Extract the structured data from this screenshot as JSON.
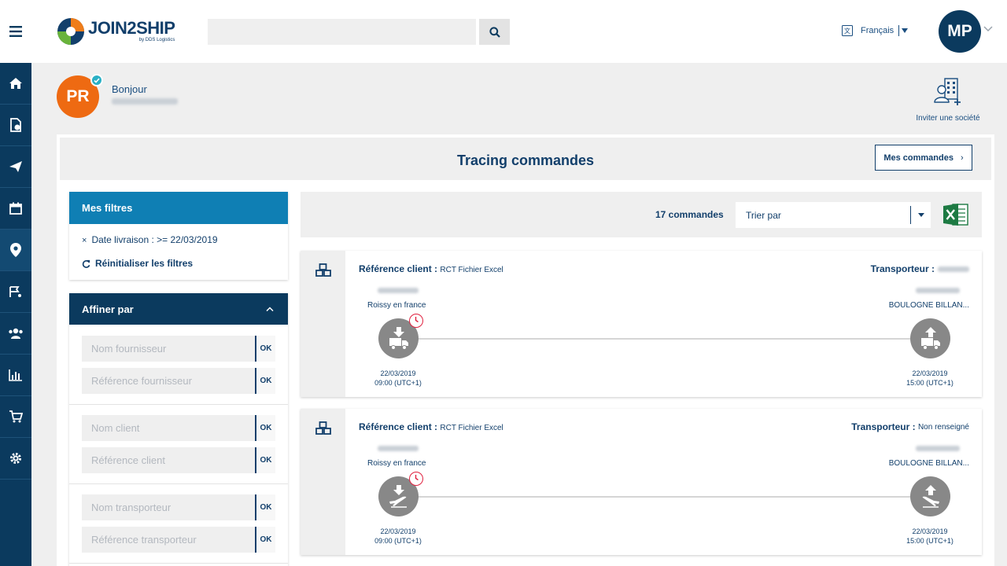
{
  "app": {
    "logo_main": "JOIN2SHIP",
    "logo_sub": "by DDS Logistics"
  },
  "header": {
    "language": "Français",
    "user_initials": "MP"
  },
  "greeting": {
    "initials": "PR",
    "hello": "Bonjour",
    "invite_label": "Inviter une société"
  },
  "page": {
    "title": "Tracing commandes",
    "my_orders_label": "Mes commandes"
  },
  "filters": {
    "title": "Mes filtres",
    "active": [
      {
        "label": "Date livraison : >= 22/03/2019"
      }
    ],
    "reset_label": "Réinitialiser les filtres"
  },
  "refine": {
    "title": "Affiner par",
    "ok_label": "OK",
    "fields": [
      {
        "placeholder": "Nom fournisseur"
      },
      {
        "placeholder": "Référence fournisseur"
      },
      {
        "placeholder": "Nom client"
      },
      {
        "placeholder": "Référence client"
      },
      {
        "placeholder": "Nom transporteur"
      },
      {
        "placeholder": "Référence transporteur"
      }
    ]
  },
  "results": {
    "count_label": "17 commandes",
    "sort_label": "Trier par"
  },
  "orders": [
    {
      "ref_label": "Référence client :",
      "ref_value": "RCT Fichier Excel",
      "carrier_label": "Transporteur :",
      "carrier_value": "",
      "origin_city": "Roissy en france",
      "dest_city": "BOULOGNE BILLAN...",
      "start_date": "22/03/2019",
      "start_time": "09:00 (UTC+1)",
      "end_date": "22/03/2019",
      "end_time": "15:00 (UTC+1)",
      "mode": "truck"
    },
    {
      "ref_label": "Référence client :",
      "ref_value": "RCT Fichier Excel",
      "carrier_label": "Transporteur :",
      "carrier_value": "Non renseigné",
      "origin_city": "Roissy en france",
      "dest_city": "BOULOGNE BILLAN...",
      "start_date": "22/03/2019",
      "start_time": "09:00 (UTC+1)",
      "end_date": "22/03/2019",
      "end_time": "15:00 (UTC+1)",
      "mode": "plane"
    }
  ],
  "colors": {
    "sidebar": "#0b3a5e",
    "primary_text": "#123f6b",
    "filters_header": "#0f7fb4",
    "orange_avatar": "#ee6a12",
    "alert_red": "#e0213f",
    "excel_green": "#1d7a43"
  },
  "icons": {
    "sidebar": [
      "home-icon",
      "document-icon",
      "paper-plane-icon",
      "calendar-icon",
      "map-pin-icon",
      "route-flag-icon",
      "users-icon",
      "bar-chart-icon",
      "cart-icon",
      "gear-icon"
    ]
  }
}
